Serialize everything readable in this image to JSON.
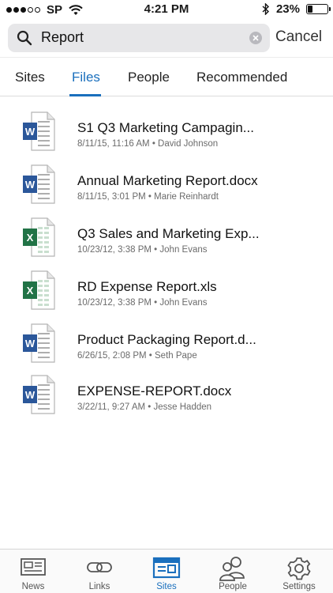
{
  "status_bar": {
    "carrier": "SP",
    "time": "4:21 PM",
    "battery_text": "23%",
    "battery_level": 0.23
  },
  "search": {
    "query": "Report",
    "cancel_label": "Cancel"
  },
  "tabs": [
    {
      "label": "Sites",
      "active": false
    },
    {
      "label": "Files",
      "active": true
    },
    {
      "label": "People",
      "active": false
    },
    {
      "label": "Recommended",
      "active": false
    }
  ],
  "files": [
    {
      "name": "S1 Q3 Marketing Campagin...",
      "meta": "8/11/15, 11:16 AM • David Johnson",
      "type": "word"
    },
    {
      "name": "Annual Marketing Report.docx",
      "meta": "8/11/15, 3:01 PM • Marie Reinhardt",
      "type": "word"
    },
    {
      "name": "Q3 Sales and Marketing Exp...",
      "meta": "10/23/12, 3:38 PM • John Evans",
      "type": "excel"
    },
    {
      "name": "RD Expense Report.xls",
      "meta": "10/23/12, 3:38 PM • John Evans",
      "type": "excel"
    },
    {
      "name": "Product Packaging Report.d...",
      "meta": "6/26/15, 2:08 PM • Seth Pape",
      "type": "word"
    },
    {
      "name": "EXPENSE-REPORT.docx",
      "meta": "3/22/11, 9:27 AM • Jesse Hadden",
      "type": "word"
    }
  ],
  "tab_bar": [
    {
      "label": "News",
      "icon": "news-icon",
      "active": false
    },
    {
      "label": "Links",
      "icon": "links-icon",
      "active": false
    },
    {
      "label": "Sites",
      "icon": "sites-icon",
      "active": true
    },
    {
      "label": "People",
      "icon": "people-icon",
      "active": false
    },
    {
      "label": "Settings",
      "icon": "settings-icon",
      "active": false
    }
  ],
  "colors": {
    "accent": "#1a6fbd",
    "word": "#2b579a",
    "excel": "#217346"
  }
}
